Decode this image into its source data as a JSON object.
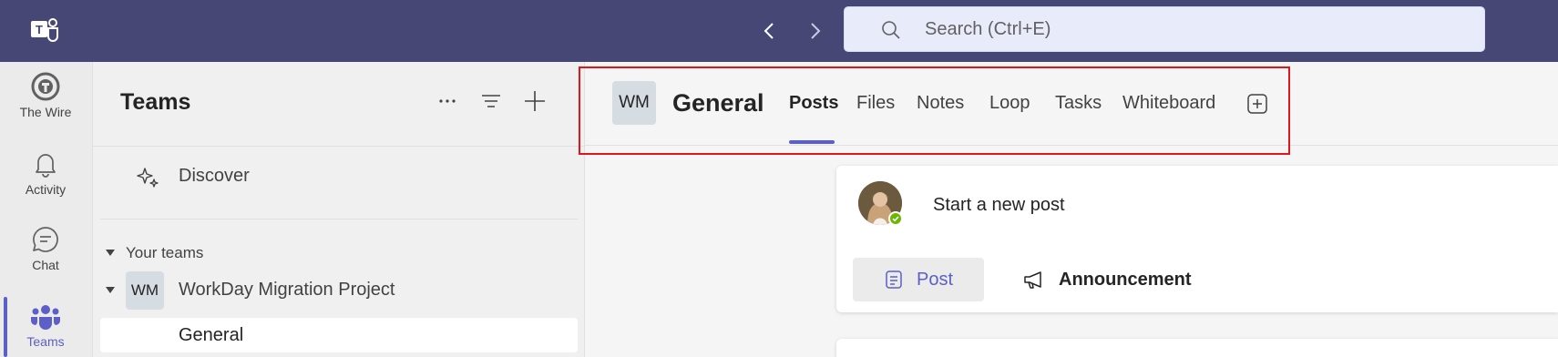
{
  "topbar": {
    "app_icon": "teams-logo-icon",
    "back_icon": "chevron-left-icon",
    "forward_icon": "chevron-right-icon",
    "search_placeholder": "Search (Ctrl+E)",
    "bar_color": "#464775"
  },
  "rail": {
    "items": [
      {
        "label": "The Wire",
        "icon": "the-wire-icon"
      },
      {
        "label": "Activity",
        "icon": "bell-icon"
      },
      {
        "label": "Chat",
        "icon": "chat-icon"
      },
      {
        "label": "Teams",
        "icon": "teams-icon",
        "active": true
      }
    ]
  },
  "panel": {
    "title": "Teams",
    "more_icon": "more-icon",
    "filter_icon": "filter-icon",
    "add_icon": "add-icon",
    "discover_label": "Discover",
    "your_teams_label": "Your teams",
    "team": {
      "initials": "WM",
      "name": "WorkDay Migration Project"
    },
    "channel": {
      "name": "General"
    }
  },
  "channel_header": {
    "initials": "WM",
    "title": "General",
    "tabs": [
      {
        "label": "Posts",
        "active": true
      },
      {
        "label": "Files"
      },
      {
        "label": "Notes"
      },
      {
        "label": "Loop"
      },
      {
        "label": "Tasks"
      },
      {
        "label": "Whiteboard"
      }
    ],
    "add_tab_icon": "add-tab-icon",
    "highlight_color": "#e0151b"
  },
  "compose": {
    "start_post": "Start a new post",
    "post_label": "Post",
    "announcement_label": "Announcement",
    "accent_color": "#5b5fc7",
    "presence": "available"
  }
}
